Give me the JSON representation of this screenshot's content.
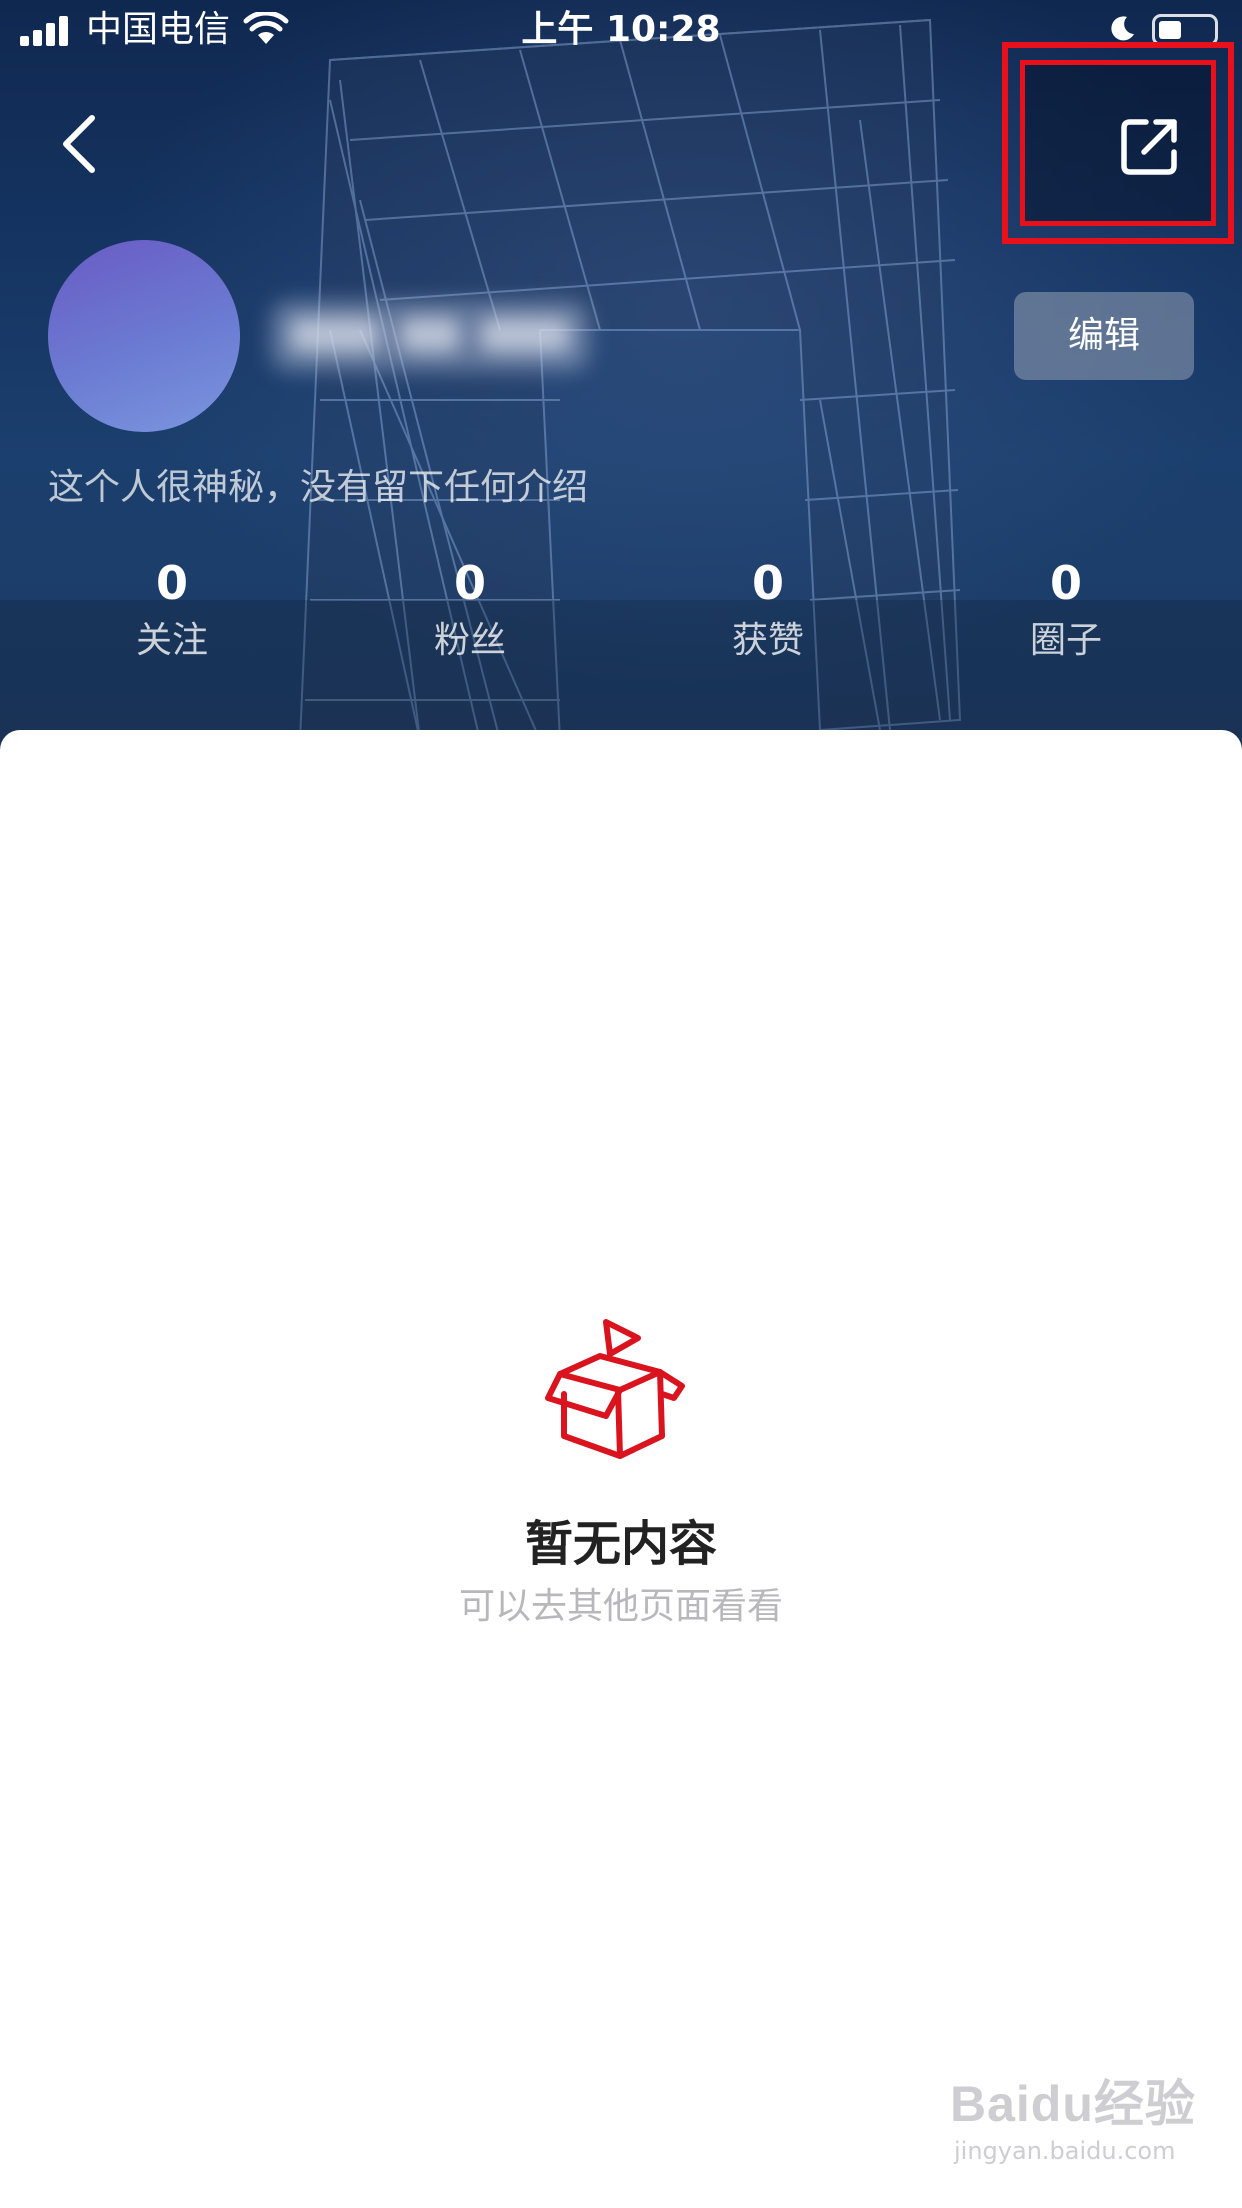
{
  "status_bar": {
    "carrier": "中国电信",
    "time": "上午 10:28"
  },
  "nav": {
    "back_icon": "chevron-left-icon",
    "share_icon": "share-external-icon",
    "highlight_color": "#e8101a"
  },
  "profile": {
    "edit_label": "编辑",
    "bio": "这个人很神秘，没有留下任何介绍"
  },
  "stats": [
    {
      "value": "0",
      "label": "关注"
    },
    {
      "value": "0",
      "label": "粉丝"
    },
    {
      "value": "0",
      "label": "获赞"
    },
    {
      "value": "0",
      "label": "圈子"
    }
  ],
  "empty_state": {
    "icon": "empty-box-icon",
    "title": "暂无内容",
    "subtitle": "可以去其他页面看看",
    "accent_color": "#d9141e"
  },
  "watermark": {
    "logo": "Baidu经验",
    "url": "jingyan.baidu.com"
  }
}
